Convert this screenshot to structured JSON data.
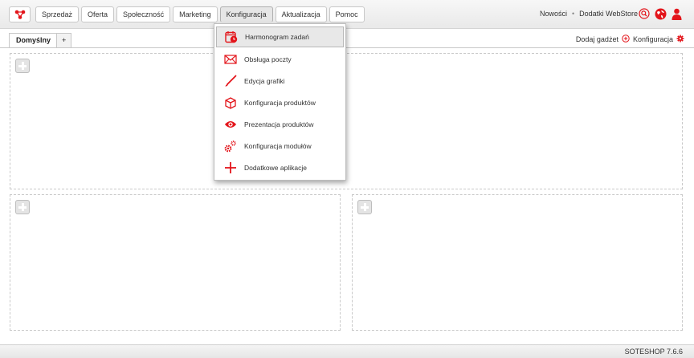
{
  "colors": {
    "accent": "#e3151b",
    "border": "#c8c8c8",
    "highlight": "#e8e8e8"
  },
  "topbar": {
    "logo_icon": "soteshop-logo-icon",
    "nav": [
      {
        "label": "Sprzedaż"
      },
      {
        "label": "Oferta"
      },
      {
        "label": "Społeczność"
      },
      {
        "label": "Marketing"
      },
      {
        "label": "Konfiguracja",
        "active": true
      },
      {
        "label": "Aktualizacja"
      },
      {
        "label": "Pomoc"
      }
    ],
    "links": {
      "news": "Nowości",
      "separator": "•",
      "webstore": "Dodatki WebStore"
    },
    "icons": [
      "search-icon",
      "globe-icon",
      "user-icon"
    ]
  },
  "tabs": {
    "items": [
      {
        "label": "Domyślny"
      },
      {
        "label": "+"
      }
    ],
    "add_gadget": "Dodaj gadżet",
    "config": "Konfiguracja"
  },
  "dropdown": {
    "items": [
      {
        "label": "Harmonogram zadań",
        "icon": "calendar-clock-icon",
        "highlighted": true
      },
      {
        "label": "Obsługa poczty",
        "icon": "envelope-icon"
      },
      {
        "label": "Edycja grafiki",
        "icon": "brush-icon"
      },
      {
        "label": "Konfiguracja produktów",
        "icon": "box-icon"
      },
      {
        "label": "Prezentacja produktów",
        "icon": "eye-icon"
      },
      {
        "label": "Konfiguracja modułów",
        "icon": "gears-icon"
      },
      {
        "label": "Dodatkowe aplikacje",
        "icon": "plus-icon"
      }
    ]
  },
  "footer": {
    "version": "SOTESHOP 7.6.6"
  }
}
